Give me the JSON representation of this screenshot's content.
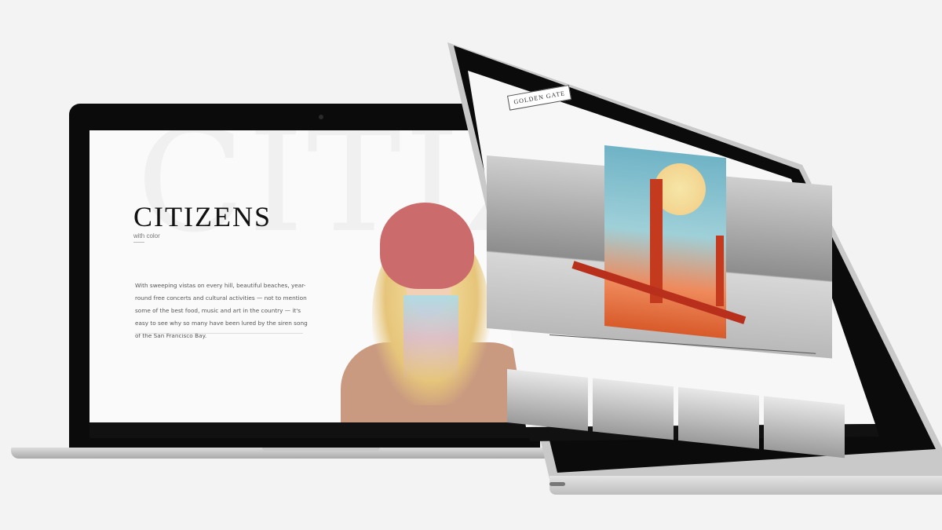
{
  "left_site": {
    "background_word": "CITIZ",
    "title": "CITIZENS",
    "subtitle": "with color",
    "paragraph": "With sweeping vistas on every hill, beautiful beaches, year-round free concerts and cultural activities — not to mention some of the best food, music and art in the country — it's easy to see why so many have been lured by the siren song of the San Francisco Bay."
  },
  "right_site": {
    "badge": "GOLDEN GATE"
  },
  "colors": {
    "background": "#f3f3f3",
    "laptop_bezel": "#0b0b0b",
    "bridge_red": "#c33a1f",
    "beanie_pink": "#cc6b6b"
  }
}
